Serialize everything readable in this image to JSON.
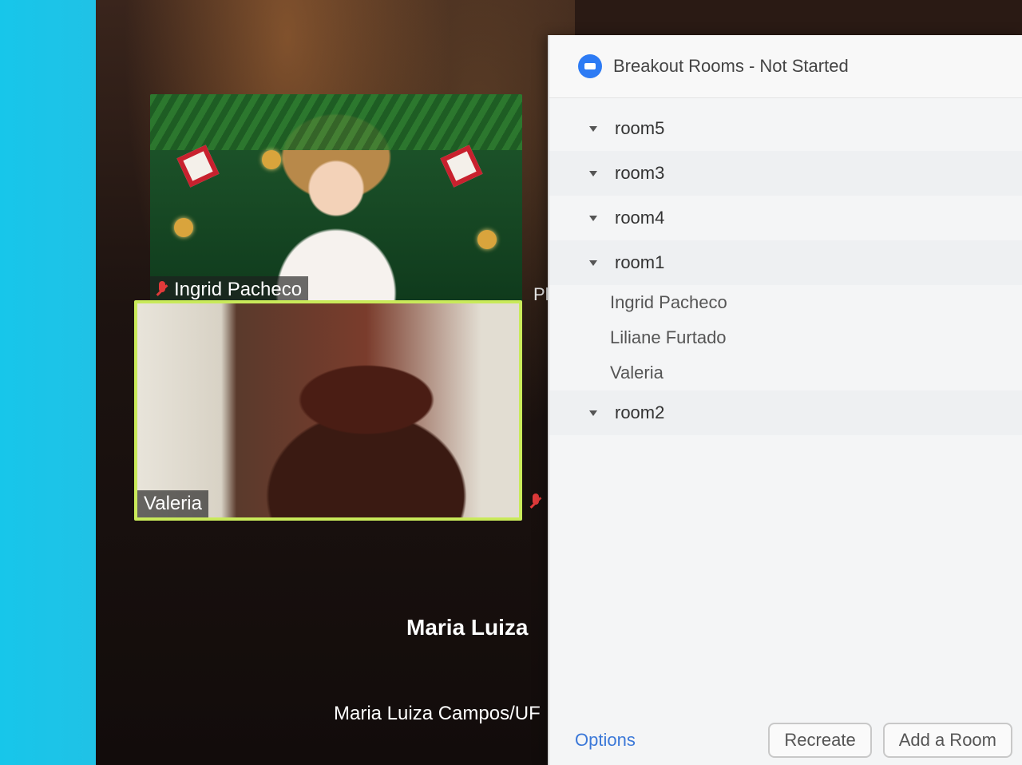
{
  "meeting": {
    "tiles": [
      {
        "name": "Ingrid Pacheco"
      },
      {
        "name": "Valeria"
      }
    ],
    "partial_side_text": "Ple",
    "audio_only": {
      "display_name": "Maria  Luiza",
      "full_name": "Maria Luiza Campos/UF"
    }
  },
  "breakout_panel": {
    "title": "Breakout Rooms - Not Started",
    "rooms": [
      {
        "name": "room5",
        "participants": []
      },
      {
        "name": "room3",
        "participants": []
      },
      {
        "name": "room4",
        "participants": []
      },
      {
        "name": "room1",
        "participants": [
          "Ingrid Pacheco",
          "Liliane Furtado",
          "Valeria"
        ]
      },
      {
        "name": "room2",
        "participants": []
      }
    ],
    "footer": {
      "options_label": "Options",
      "recreate_label": "Recreate",
      "add_room_label": "Add a Room"
    }
  },
  "colors": {
    "accent": "#2d7bf4",
    "active_speaker_border": "#c9ea5a",
    "muted_mic": "#e03a3a",
    "options_link": "#3b78d8"
  }
}
